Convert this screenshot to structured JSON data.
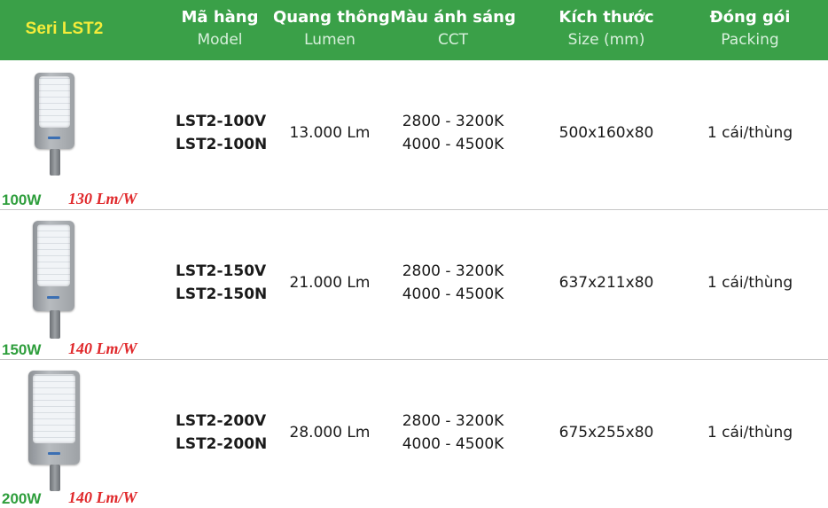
{
  "header": {
    "series": "Seri LST2",
    "columns": [
      {
        "vn": "Mã hàng",
        "en": "Model"
      },
      {
        "vn": "Quang thông",
        "en": "Lumen"
      },
      {
        "vn": "Màu ánh sáng",
        "en": "CCT"
      },
      {
        "vn": "Kích thước",
        "en": "Size (mm)"
      },
      {
        "vn": "Đóng gói",
        "en": "Packing"
      }
    ]
  },
  "colors": {
    "header_bg": "#3aa048",
    "series_title": "#f5ec3a",
    "wattage": "#2e9e3c",
    "efficacy": "#e0282b"
  },
  "products": [
    {
      "wattage": "100W",
      "efficacy": "130 Lm/W",
      "model_v": "LST2-100V",
      "model_n": "LST2-100N",
      "lumen": "13.000 Lm",
      "cct_1": "2800 - 3200K",
      "cct_2": "4000 - 4500K",
      "size": "500x160x80",
      "packing": "1 cái/thùng"
    },
    {
      "wattage": "150W",
      "efficacy": "140 Lm/W",
      "model_v": "LST2-150V",
      "model_n": "LST2-150N",
      "lumen": "21.000 Lm",
      "cct_1": "2800 - 3200K",
      "cct_2": "4000 - 4500K",
      "size": "637x211x80",
      "packing": "1 cái/thùng"
    },
    {
      "wattage": "200W",
      "efficacy": "140 Lm/W",
      "model_v": "LST2-200V",
      "model_n": "LST2-200N",
      "lumen": "28.000 Lm",
      "cct_1": "2800 - 3200K",
      "cct_2": "4000 - 4500K",
      "size": "675x255x80",
      "packing": "1 cái/thùng"
    }
  ]
}
